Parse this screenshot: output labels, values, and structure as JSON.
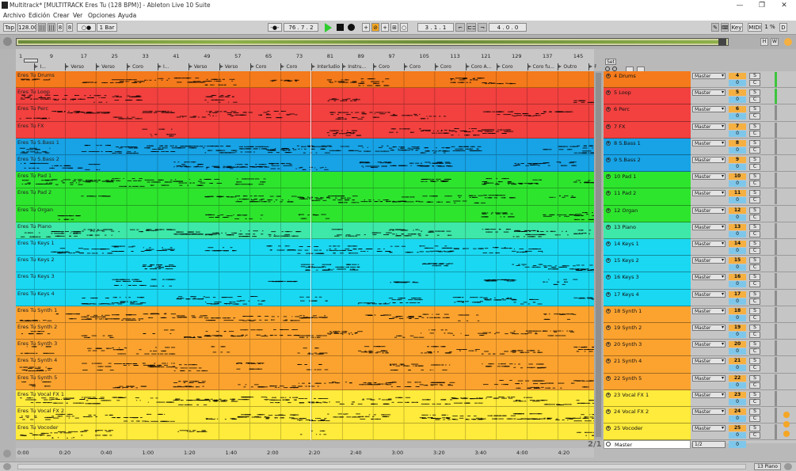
{
  "window": {
    "title": "Multitrack* [MULTITRACK Eres Tu (128 BPM)] - Ableton Live 10 Suite",
    "minimize": "—",
    "maximize": "❐",
    "close": "✕"
  },
  "menu": [
    "Archivo",
    "Edición",
    "Crear",
    "Ver",
    "Opciones",
    "Ayuda"
  ],
  "transport": {
    "tap": "Tap",
    "tempo": "128.00",
    "signature_num": "8",
    "signature_den": "8",
    "metronome": "○●",
    "quantize": "1 Bar",
    "punch_follow": "-●-",
    "position": "76 .   7 .   2",
    "loop_start": "3 .   1 .   1",
    "loop_length": "4 .   0 .   0",
    "key": "Key",
    "midi": "MIDI",
    "cpu": "1 %",
    "disk": "D"
  },
  "set_button": "Set",
  "ruler": {
    "bars": [
      "1",
      "9",
      "17",
      "25",
      "33",
      "41",
      "49",
      "57",
      "65",
      "73",
      "81",
      "89",
      "97",
      "105",
      "113",
      "121",
      "129",
      "137",
      "145"
    ],
    "locators": [
      {
        "label": "I..."
      },
      {
        "label": "Verso"
      },
      {
        "label": "Verso"
      },
      {
        "label": "Coro"
      },
      {
        "label": "I..."
      },
      {
        "label": "Verso"
      },
      {
        "label": "Verso"
      },
      {
        "label": "Coro"
      },
      {
        "label": "Coro"
      },
      {
        "label": "Interludio"
      },
      {
        "label": "Instru..."
      },
      {
        "label": "Coro"
      },
      {
        "label": "Coro"
      },
      {
        "label": "Coro"
      },
      {
        "label": "Coro A..."
      },
      {
        "label": "Coro"
      },
      {
        "label": "Coro fu..."
      },
      {
        "label": "Outro"
      },
      {
        "label": "Final"
      }
    ]
  },
  "tracks": [
    {
      "clip": "Eres Tu Drums",
      "name": "4 Drums",
      "num": "4",
      "color": "#f47a1b",
      "numcolor": "#f5b041"
    },
    {
      "clip": "Eres Tu Loop",
      "name": "5 Loop",
      "num": "5",
      "color": "#f2413f",
      "numcolor": "#f5b041"
    },
    {
      "clip": "Eres Tu Perc",
      "name": "6 Perc",
      "num": "6",
      "color": "#f2413f",
      "numcolor": "#f5b041"
    },
    {
      "clip": "Eres Tu FX",
      "name": "7 FX",
      "num": "7",
      "color": "#f2413f",
      "numcolor": "#f5b041"
    },
    {
      "clip": "Eres Tu S.Bass 1",
      "name": "8 S.Bass 1",
      "num": "8",
      "color": "#17a3e6",
      "numcolor": "#f5b041"
    },
    {
      "clip": "Eres Tu S.Bass 2",
      "name": "9 S.Bass 2",
      "num": "9",
      "color": "#17a3e6",
      "numcolor": "#f5b041"
    },
    {
      "clip": "Eres Tu Pad 1",
      "name": "10 Pad 1",
      "num": "10",
      "color": "#2ee52e",
      "numcolor": "#f5b041"
    },
    {
      "clip": "Eres Tu Pad 2",
      "name": "11 Pad 2",
      "num": "11",
      "color": "#2ee52e",
      "numcolor": "#f5b041"
    },
    {
      "clip": "Eres Tu Organ",
      "name": "12 Organ",
      "num": "12",
      "color": "#2ee52e",
      "numcolor": "#f5b041"
    },
    {
      "clip": "Eres Tu Piano",
      "name": "13 Piano",
      "num": "13",
      "color": "#3de8a8",
      "numcolor": "#f5b041"
    },
    {
      "clip": "Eres Tu Keys 1",
      "name": "14 Keys 1",
      "num": "14",
      "color": "#1ad8f2",
      "numcolor": "#f5b041"
    },
    {
      "clip": "Eres Tu Keys 2",
      "name": "15 Keys 2",
      "num": "15",
      "color": "#1ad8f2",
      "numcolor": "#f5b041"
    },
    {
      "clip": "Eres Tu Keys 3",
      "name": "16 Keys 3",
      "num": "16",
      "color": "#1ad8f2",
      "numcolor": "#f5b041"
    },
    {
      "clip": "Eres Tu Keys 4",
      "name": "17 Keys 4",
      "num": "17",
      "color": "#1ad8f2",
      "numcolor": "#f5b041"
    },
    {
      "clip": "Eres Tu Synth 1",
      "name": "18 Synth 1",
      "num": "18",
      "color": "#fca32f",
      "numcolor": "#f5b041"
    },
    {
      "clip": "Eres Tu Synth 2",
      "name": "19 Synth 2",
      "num": "19",
      "color": "#fca32f",
      "numcolor": "#f5b041"
    },
    {
      "clip": "Eres Tu Synth 3",
      "name": "20 Synth 3",
      "num": "20",
      "color": "#fca32f",
      "numcolor": "#f5b041"
    },
    {
      "clip": "Eres Tu Synth 4",
      "name": "21 Synth 4",
      "num": "21",
      "color": "#fca32f",
      "numcolor": "#f5b041"
    },
    {
      "clip": "Eres Tu Synth 5",
      "name": "22 Synth 5",
      "num": "22",
      "color": "#fca32f",
      "numcolor": "#f5b041"
    },
    {
      "clip": "Eres Tu Vocal FX 1",
      "name": "23 Vocal FX 1",
      "num": "23",
      "color": "#ffeb3b",
      "numcolor": "#f5b041"
    },
    {
      "clip": "Eres Tu Vocal FX 2",
      "name": "24 Vocal FX 2",
      "num": "24",
      "color": "#ffeb3b",
      "numcolor": "#f5b041"
    },
    {
      "clip": "Eres Tu Vocoder",
      "name": "25 Vocoder",
      "num": "25",
      "color": "#ffeb3b",
      "numcolor": "#f5b041"
    }
  ],
  "mixer": {
    "route_label": "Master",
    "send_value": "0",
    "solo": "S",
    "cue": "C"
  },
  "master": {
    "name": "Master",
    "route": "1/2",
    "value": "0"
  },
  "page_indicator": "2/1",
  "timeline": [
    "0:00",
    "0:20",
    "0:40",
    "1:00",
    "1:20",
    "1:40",
    "2:00",
    "2:20",
    "2:40",
    "3:00",
    "3:20",
    "3:40",
    "4:00",
    "4:20"
  ],
  "status": {
    "selected_track": "13 Piano"
  },
  "colors": {
    "background": "#b9b9b9",
    "accent_green": "#2ecc2e",
    "send": "#7fc7ea"
  }
}
